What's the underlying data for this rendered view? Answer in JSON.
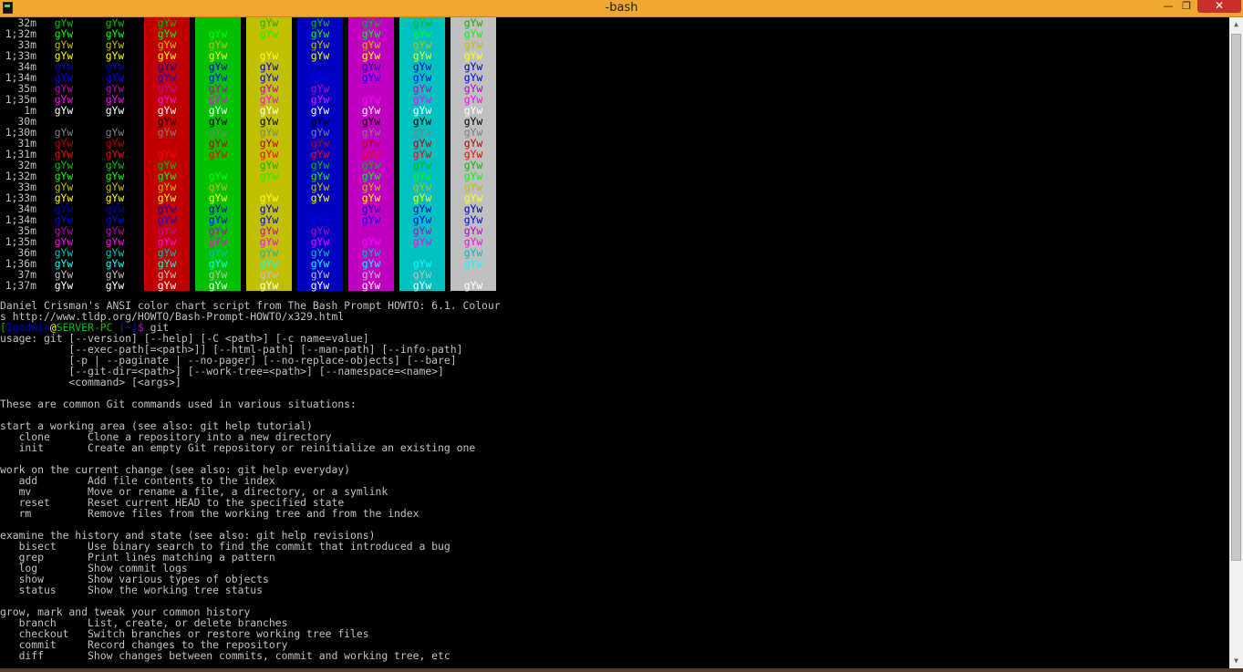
{
  "window": {
    "title": "-bash",
    "min_glyph": "—",
    "max_glyph": "❐",
    "close_glyph": "✕"
  },
  "scrollbar": {
    "up_glyph": "▲",
    "down_glyph": "▼"
  },
  "colors": {
    "background": "#000000",
    "default_fg": "#c0c0c0",
    "titlebar": "#f0a732",
    "palette": {
      "30": "#000000",
      "31": "#c00000",
      "32": "#00c000",
      "33": "#c0c000",
      "34": "#0000c0",
      "35": "#c000c0",
      "36": "#00c0c0",
      "37": "#c0c0c0",
      "1;30": "#808080",
      "1;31": "#ff0000",
      "1;32": "#00ff00",
      "1;33": "#ffff00",
      "1;34": "#0000ff",
      "1;35": "#ff00ff",
      "1;36": "#00ffff",
      "1;37": "#ffffff",
      "1": "#ffffff",
      "m": "#c0c0c0"
    },
    "backgrounds": [
      "#c00000",
      "#00c000",
      "#c0c000",
      "#0000c0",
      "#c000c0",
      "#00c0c0",
      "#c0c0c0"
    ]
  },
  "color_chart": {
    "sample_text": "gYw",
    "rows": [
      "32m",
      "1;32m",
      "33m",
      "1;33m",
      "34m",
      "1;34m",
      "35m",
      "1;35m",
      "1m",
      "30m",
      "1;30m",
      "31m",
      "1;31m",
      "32m",
      "1;32m",
      "33m",
      "1;33m",
      "34m",
      "1;34m",
      "35m",
      "1;35m",
      "36m",
      "1;36m",
      "37m",
      "1;37m"
    ]
  },
  "credit_lines": [
    "Daniel Crisman's ANSI color chart script from The Bash Prompt HOWTO: 6.1. Colour",
    "s http://www.tldp.org/HOWTO/Bash-Prompt-HOWTO/x329.html"
  ],
  "prompt": {
    "open": "[",
    "user": "Igodwin",
    "at": "@",
    "host": "SERVER-PC",
    "path": " [~]",
    "dollar": "$",
    "command": " git"
  },
  "output_lines": [
    "usage: git [--version] [--help] [-C <path>] [-c name=value]",
    "           [--exec-path[=<path>]] [--html-path] [--man-path] [--info-path]",
    "           [-p | --paginate | --no-pager] [--no-replace-objects] [--bare]",
    "           [--git-dir=<path>] [--work-tree=<path>] [--namespace=<name>]",
    "           <command> [<args>]",
    "",
    "These are common Git commands used in various situations:",
    "",
    "start a working area (see also: git help tutorial)",
    "   clone      Clone a repository into a new directory",
    "   init       Create an empty Git repository or reinitialize an existing one",
    "",
    "work on the current change (see also: git help everyday)",
    "   add        Add file contents to the index",
    "   mv         Move or rename a file, a directory, or a symlink",
    "   reset      Reset current HEAD to the specified state",
    "   rm         Remove files from the working tree and from the index",
    "",
    "examine the history and state (see also: git help revisions)",
    "   bisect     Use binary search to find the commit that introduced a bug",
    "   grep       Print lines matching a pattern",
    "   log        Show commit logs",
    "   show       Show various types of objects",
    "   status     Show the working tree status",
    "",
    "grow, mark and tweak your common history",
    "   branch     List, create, or delete branches",
    "   checkout   Switch branches or restore working tree files",
    "   commit     Record changes to the repository",
    "   diff       Show changes between commits, commit and working tree, etc"
  ]
}
